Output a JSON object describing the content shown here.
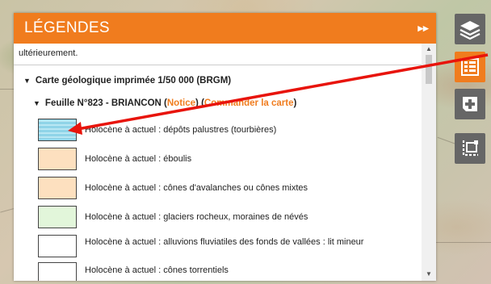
{
  "legend_panel": {
    "title": "LÉGENDES",
    "collapse_icon": "double-chevron-right-icon",
    "intro_text": "ultérieurement.",
    "section_title": "Carte géologique imprimée 1/50 000 (BRGM)",
    "feuille": {
      "title": "Feuille N°823 - BRIANCON",
      "notice_open": "(",
      "notice_label": "Notice",
      "notice_close": ")",
      "order_open": "(",
      "order_label": "Commander la carte",
      "order_close": ")"
    },
    "items": [
      {
        "label": "Holocène à actuel : dépôts palustres (tourbières)",
        "color": "#8fd4e8",
        "pattern": "hatched"
      },
      {
        "label": "Holocène à actuel : éboulis",
        "color": "#fde0bf",
        "pattern": "solid"
      },
      {
        "label": "Holocène à actuel : cônes d'avalanches ou cônes mixtes",
        "color": "#fde0bf",
        "pattern": "solid"
      },
      {
        "label": "Holocène à actuel : glaciers rocheux, moraines de névés",
        "color": "#e2f6da",
        "pattern": "solid"
      },
      {
        "label": "Holocène à actuel : alluvions fluviatiles des fonds de vallées : lit mineur",
        "color": "#ffffff",
        "pattern": "solid"
      },
      {
        "label": "Holocène à actuel : cônes torrentiels",
        "color": "#ffffff",
        "pattern": "solid"
      }
    ]
  },
  "toolbar": {
    "buttons": [
      {
        "name": "layers-button",
        "icon": "layers-icon",
        "active": false
      },
      {
        "name": "legend-button",
        "icon": "legend-list-icon",
        "active": true
      },
      {
        "name": "add-data-button",
        "icon": "add-layer-icon",
        "active": false
      },
      {
        "name": "scale-button",
        "icon": "crop-scale-icon",
        "active": false
      }
    ]
  },
  "colors": {
    "accent": "#f07c1e",
    "tool_gray": "#666666",
    "annotation_arrow": "#e8140c"
  }
}
